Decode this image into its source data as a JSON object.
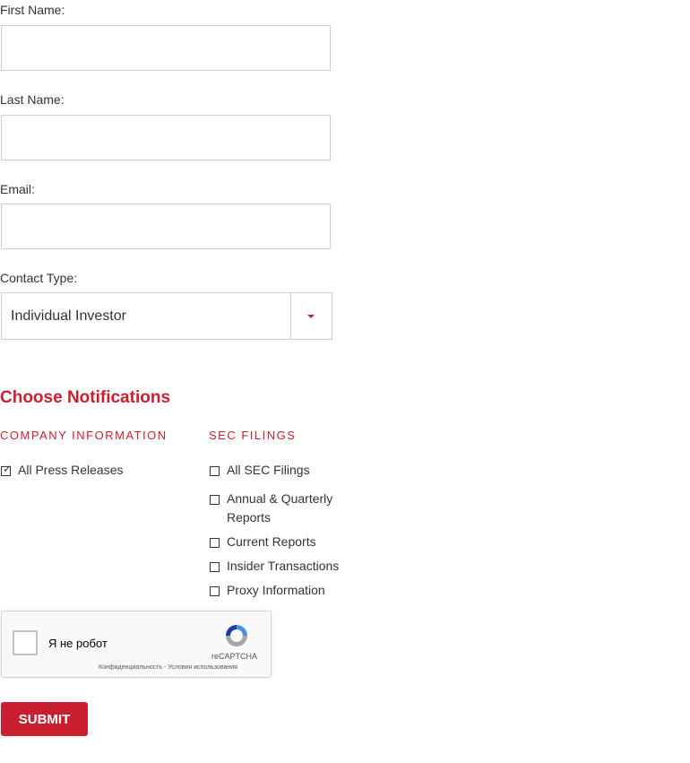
{
  "form": {
    "first_name_label": "First Name:",
    "first_name_value": "",
    "last_name_label": "Last Name:",
    "last_name_value": "",
    "email_label": "Email:",
    "email_value": "",
    "contact_type_label": "Contact Type:",
    "contact_type_value": "Individual Investor"
  },
  "notifications": {
    "heading": "Choose Notifications",
    "company_info": {
      "title": "COMPANY INFORMATION",
      "items": [
        {
          "label": "All Press Releases",
          "checked": true
        }
      ]
    },
    "sec_filings": {
      "title": "SEC FILINGS",
      "items": [
        {
          "label": "All SEC Filings",
          "checked": false
        },
        {
          "label": "Annual & Quarterly Reports",
          "checked": false
        },
        {
          "label": "Current Reports",
          "checked": false
        },
        {
          "label": "Insider Transactions",
          "checked": false
        },
        {
          "label": "Proxy Information",
          "checked": false
        }
      ]
    }
  },
  "recaptcha": {
    "label": "Я не робот",
    "brand": "reCAPTCHA",
    "links": "Конфиденциальность - Условия использования"
  },
  "submit_label": "SUBMIT",
  "colors": {
    "accent": "#c8202f",
    "border": "#cfcfcf"
  }
}
